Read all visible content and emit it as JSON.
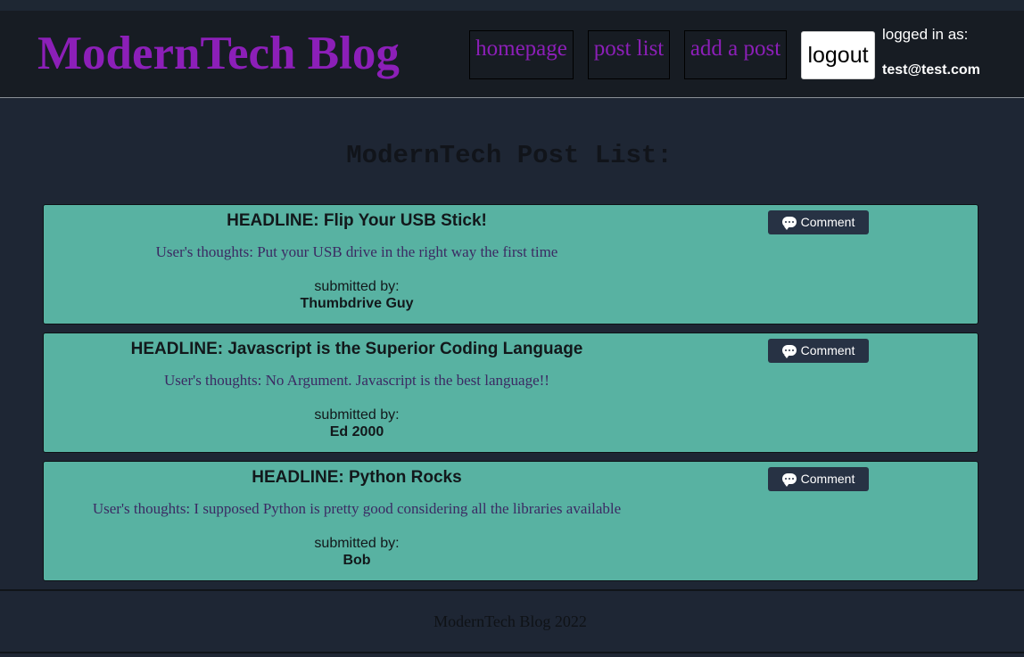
{
  "header": {
    "title": "ModernTech Blog",
    "nav": {
      "homepage": "homepage",
      "post_list": "post list",
      "add_post": "add a post"
    },
    "logout_label": "logout",
    "logged_in_label": "logged in as:",
    "logged_in_email": "test@test.com"
  },
  "main": {
    "heading": "ModernTech Post List:",
    "comment_label": "Comment",
    "posts": [
      {
        "headline": "HEADLINE: Flip Your USB Stick!",
        "thoughts": "User's thoughts: Put your USB drive in the right way the first time",
        "submitted_label": "submitted by:",
        "author": "Thumbdrive Guy"
      },
      {
        "headline": "HEADLINE: Javascript is the Superior Coding Language",
        "thoughts": "User's thoughts: No Argument. Javascript is the best language!!",
        "submitted_label": "submitted by:",
        "author": "Ed 2000"
      },
      {
        "headline": "HEADLINE: Python Rocks",
        "thoughts": "User's thoughts: I supposed Python is pretty good considering all the libraries available",
        "submitted_label": "submitted by:",
        "author": "Bob"
      }
    ]
  },
  "footer": {
    "text": "ModernTech Blog 2022"
  },
  "icons": {
    "comment": "speech-bubble-icon"
  },
  "colors": {
    "brand_purple": "#8c1fb8",
    "card_teal": "#58b2a2",
    "background": "#1e2634",
    "header_bg": "#171c23",
    "comment_button": "#273244"
  }
}
